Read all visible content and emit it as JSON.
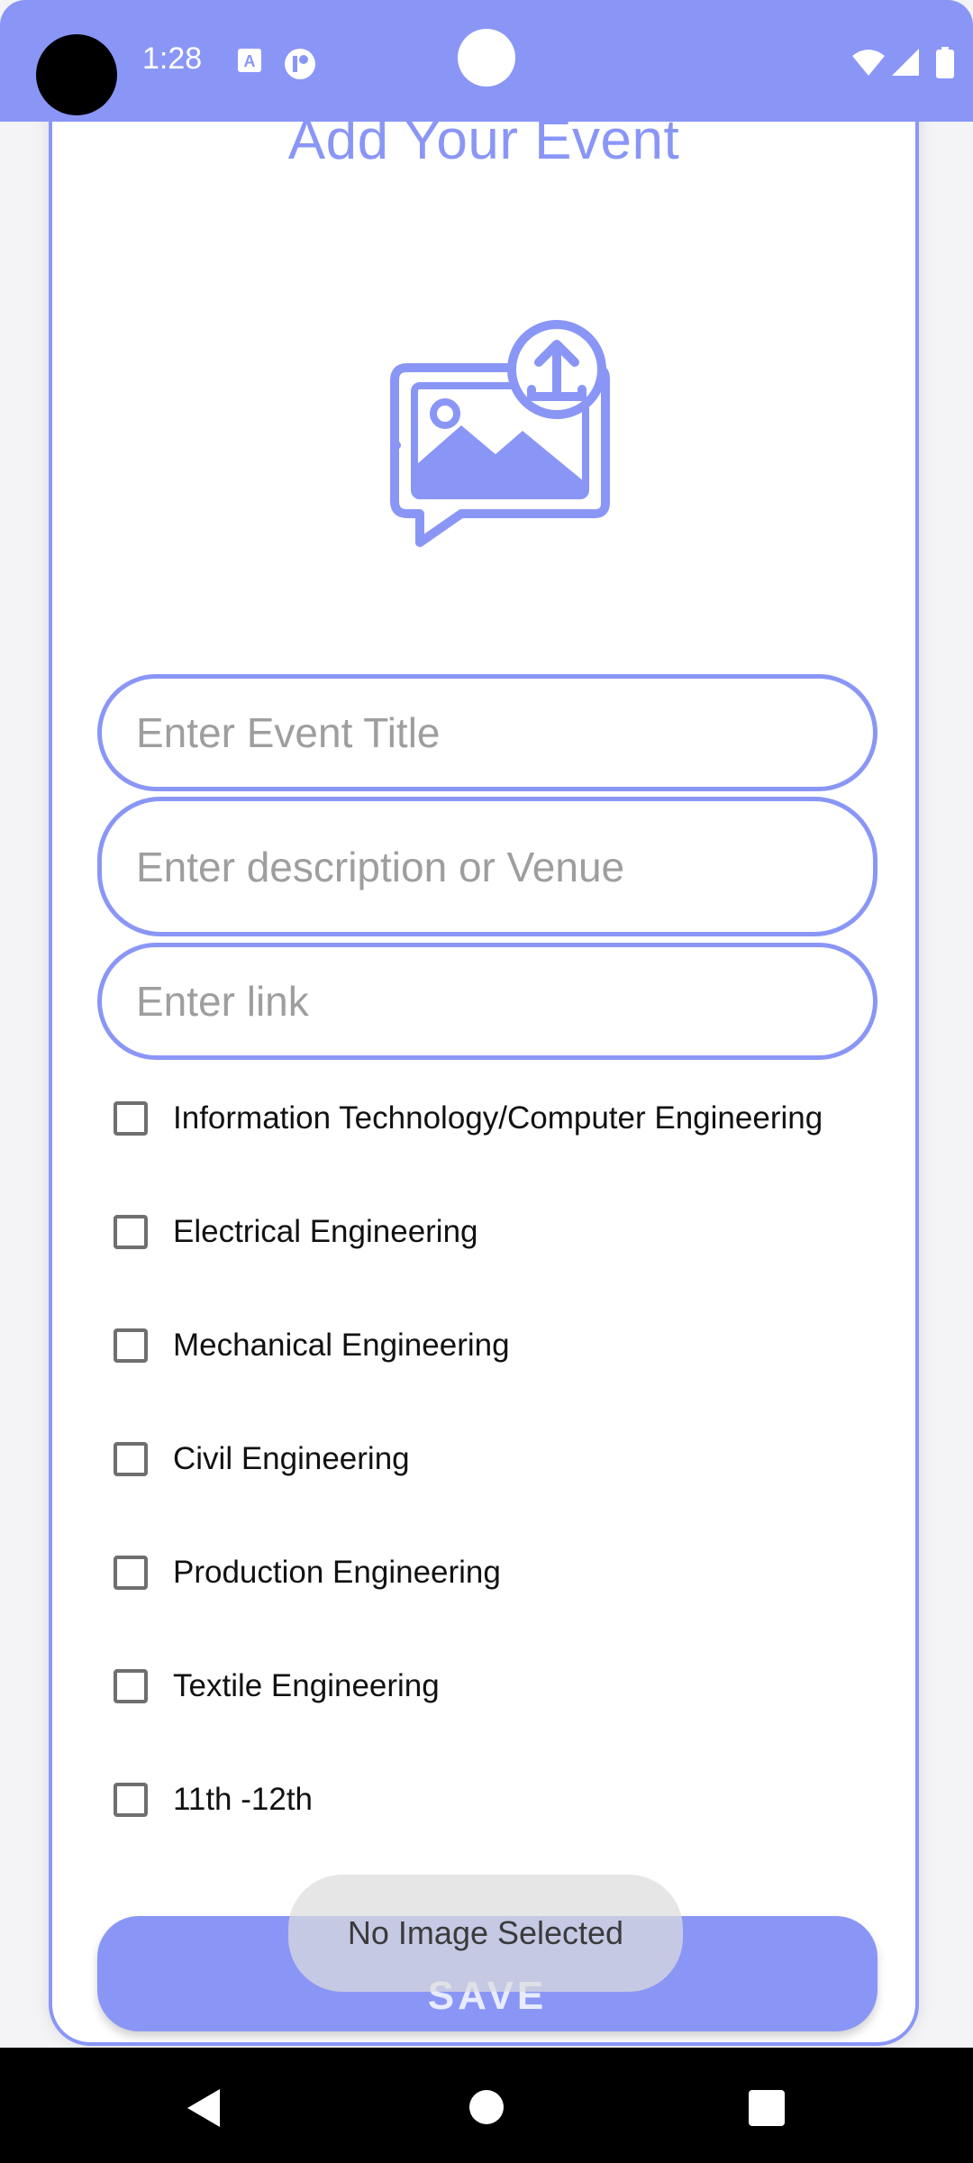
{
  "status_bar": {
    "time": "1:28"
  },
  "form": {
    "title": "Add Your Event",
    "fields": {
      "title_placeholder": "Enter Event Title",
      "desc_placeholder": "Enter description or Venue",
      "link_placeholder": "Enter link"
    },
    "departments": [
      "Information Technology/Computer Engineering",
      "Electrical Engineering",
      "Mechanical Engineering",
      "Civil Engineering",
      "Production Engineering",
      "Textile Engineering",
      "11th -12th"
    ],
    "save_label": "SAVE"
  },
  "toast": {
    "text": "No Image Selected"
  },
  "colors": {
    "accent": "#8a96f6"
  },
  "icons": {
    "status": [
      "translate-icon",
      "app-badge-icon",
      "wifi-icon",
      "signal-icon",
      "battery-icon"
    ],
    "nav": [
      "back-icon",
      "home-icon",
      "recents-icon"
    ],
    "illustration": "image-upload-icon"
  }
}
